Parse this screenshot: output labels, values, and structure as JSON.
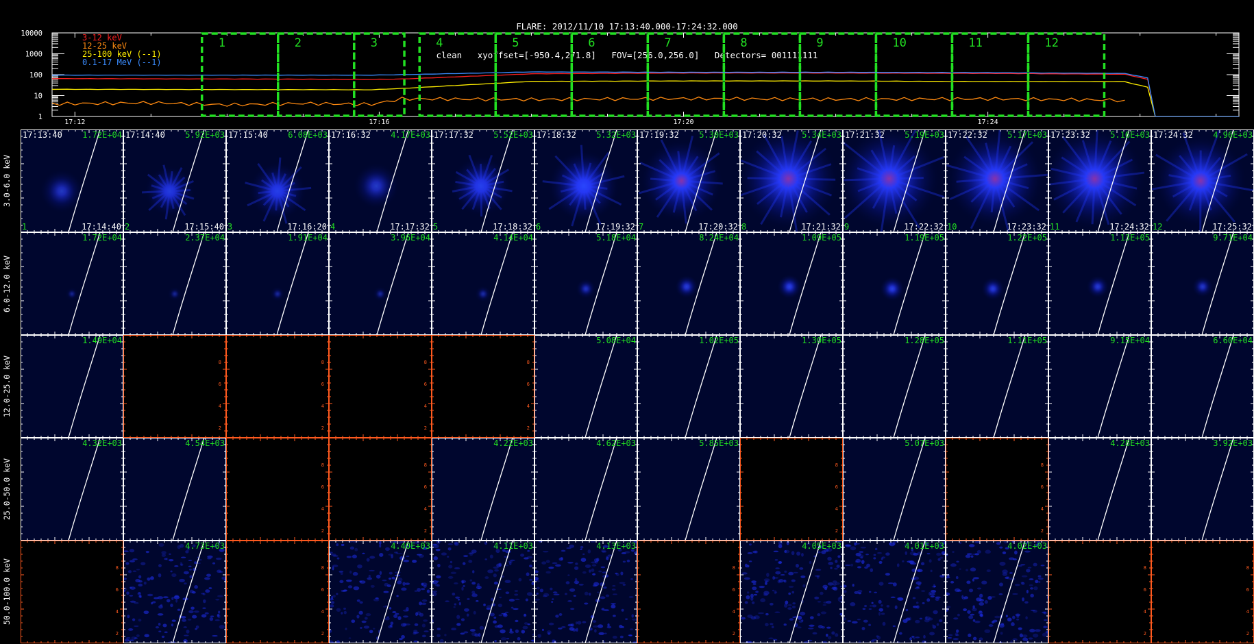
{
  "header": {
    "title": "FLARE: 2012/11/10 17:13:40.000-17:24:32.000",
    "subtitle": "clean   xyoffset=[-950.4,271.8]   FOV=[256.0,256.0]   Detectors= 001111111"
  },
  "colors": {
    "accent": "#22e022",
    "bands": [
      "#ff2020",
      "#ff8a10",
      "#ffee00",
      "#3a8cff"
    ],
    "panel_bg": "#00062e",
    "empty_axis": "#ff5a1f"
  },
  "chart_data": [
    {
      "type": "line",
      "name": "lightcurve",
      "yscale": "log",
      "ylim": [
        1,
        10000
      ],
      "y_ticks": [
        "10000",
        "1000",
        "100",
        "10",
        "1"
      ],
      "x_tick_labels": [
        "17:12",
        "17:16",
        "17:20",
        "17:24"
      ],
      "xlim_minutes": [
        11.7,
        27.3
      ],
      "legend": [
        "3-12 keV",
        "12-25 keV",
        "25-100 keV (--1)",
        "0.1-17 MeV (--1)"
      ],
      "series": [
        {
          "name": "3-12 keV",
          "x": [
            11.7,
            15.9,
            16.3,
            18.0,
            20.0,
            22.0,
            24.0,
            25.8,
            26.1,
            26.2
          ],
          "y": [
            65,
            60,
            62,
            110,
            120,
            120,
            115,
            105,
            60,
            1
          ]
        },
        {
          "name": "12-25 keV",
          "x": [
            11.7,
            13.0,
            14.0,
            15.0,
            15.9,
            16.3,
            18.0,
            20.0,
            22.0,
            24.0,
            25.8
          ],
          "y": [
            4,
            4.5,
            3.6,
            4.2,
            3.8,
            7,
            6.5,
            7.2,
            6.6,
            7,
            6
          ]
        },
        {
          "name": "25-100 keV (--1)",
          "x": [
            11.7,
            15.9,
            16.3,
            18.0,
            20.0,
            22.0,
            24.0,
            25.8,
            26.1,
            26.2
          ],
          "y": [
            20,
            19,
            22,
            48,
            50,
            50,
            47,
            46,
            25,
            1
          ]
        },
        {
          "name": "0.1-17 MeV (--1)",
          "x": [
            11.7,
            15.9,
            16.3,
            18.0,
            20.0,
            22.0,
            24.0,
            25.8,
            26.1,
            26.2
          ],
          "y": [
            95,
            95,
            100,
            135,
            130,
            130,
            125,
            115,
            70,
            1
          ]
        }
      ],
      "intervals": [
        {
          "label": "1",
          "start": 13.67,
          "end": 14.67
        },
        {
          "label": "2",
          "start": 14.67,
          "end": 15.67
        },
        {
          "label": "3",
          "start": 15.67,
          "end": 16.33
        },
        {
          "label": "4",
          "start": 16.53,
          "end": 17.53
        },
        {
          "label": "5",
          "start": 17.53,
          "end": 18.53
        },
        {
          "label": "6",
          "start": 18.53,
          "end": 19.53
        },
        {
          "label": "7",
          "start": 19.53,
          "end": 20.53
        },
        {
          "label": "8",
          "start": 20.53,
          "end": 21.53
        },
        {
          "label": "9",
          "start": 21.53,
          "end": 22.53
        },
        {
          "label": "10",
          "start": 22.53,
          "end": 23.53
        },
        {
          "label": "11",
          "start": 23.53,
          "end": 24.53
        },
        {
          "label": "12",
          "start": 24.53,
          "end": 25.53
        }
      ]
    },
    {
      "type": "heatmap",
      "name": "image-grid",
      "energy_bands": [
        "3.0-6.0 keV",
        "6.0-12.0 keV",
        "12.0-25.0 keV",
        "25.0-50.0 keV",
        "50.0-100.0 keV"
      ],
      "start_times": [
        "17:13:40",
        "17:14:40",
        "17:15:40",
        "17:16:32",
        "17:17:32",
        "17:18:32",
        "17:19:32",
        "17:20:32",
        "17:21:32",
        "17:22:32",
        "17:23:32",
        "17:24:32"
      ],
      "end_times": [
        "17:14:40",
        "17:15:40",
        "17:16:20",
        "17:17:32",
        "17:18:32",
        "17:19:32",
        "17:20:32",
        "17:21:32",
        "17:22:32",
        "17:23:32",
        "17:24:32",
        "17:25:32"
      ],
      "interval_labels": [
        "1",
        "2",
        "3",
        "4",
        "5",
        "6",
        "7",
        "8",
        "9",
        "10",
        "11",
        "12"
      ],
      "peaks": [
        [
          "1.72E+04",
          "5.92E+03",
          "6.08E+03",
          "4.17E+03",
          "5.52E+03",
          "5.32E+03",
          "5.30E+03",
          "5.34E+03",
          "5.19E+03",
          "5.17E+03",
          "5.16E+03",
          "4.96E+03"
        ],
        [
          "1.72E+04",
          "2.37E+04",
          "1.91E+04",
          "3.96E+04",
          "4.14E+04",
          "5.18E+04",
          "8.24E+04",
          "1.09E+05",
          "1.19E+05",
          "1.22E+05",
          "1.13E+05",
          "9.71E+04"
        ],
        [
          "1.49E+04",
          "",
          "",
          "",
          "",
          "5.08E+04",
          "1.02E+05",
          "1.30E+05",
          "1.28E+05",
          "1.11E+05",
          "9.15E+04",
          "6.60E+04"
        ],
        [
          "4.32E+03",
          "4.54E+03",
          "",
          "",
          "4.22E+03",
          "4.62E+03",
          "5.85E+03",
          "",
          "5.07E+03",
          "",
          "4.28E+03",
          "3.92E+03"
        ],
        [
          "",
          "4.73E+03",
          "",
          "4.40E+03",
          "4.11E+03",
          "4.13E+03",
          "",
          "4.05E+03",
          "4.01E+03",
          "4.02E+03",
          "",
          ""
        ]
      ],
      "source": [
        [
          [
            0.4,
            0.6
          ],
          [
            0.45,
            0.6
          ],
          [
            0.5,
            0.6
          ],
          [
            0.46,
            0.55
          ],
          [
            0.48,
            0.55
          ],
          [
            0.48,
            0.55
          ],
          [
            0.43,
            0.5
          ],
          [
            0.47,
            0.48
          ],
          [
            0.45,
            0.48
          ],
          [
            0.48,
            0.48
          ],
          [
            0.45,
            0.48
          ],
          [
            0.48,
            0.5
          ]
        ],
        [
          [
            0.5,
            0.6
          ],
          [
            0.5,
            0.6
          ],
          [
            0.5,
            0.6
          ],
          [
            0.5,
            0.6
          ],
          [
            0.5,
            0.6
          ],
          [
            0.5,
            0.55
          ],
          [
            0.48,
            0.53
          ],
          [
            0.48,
            0.53
          ],
          [
            0.48,
            0.55
          ],
          [
            0.46,
            0.55
          ],
          [
            0.48,
            0.53
          ],
          [
            0.5,
            0.53
          ]
        ]
      ],
      "intensity": [
        [
          0.55,
          0.7,
          0.85,
          0.6,
          0.9,
          1.15,
          1.4,
          1.8,
          1.8,
          1.7,
          1.8,
          1.6
        ],
        [
          0.05,
          0.1,
          0.15,
          0.15,
          0.25,
          0.5,
          0.75,
          0.85,
          0.85,
          0.75,
          0.7,
          0.6
        ]
      ]
    }
  ]
}
